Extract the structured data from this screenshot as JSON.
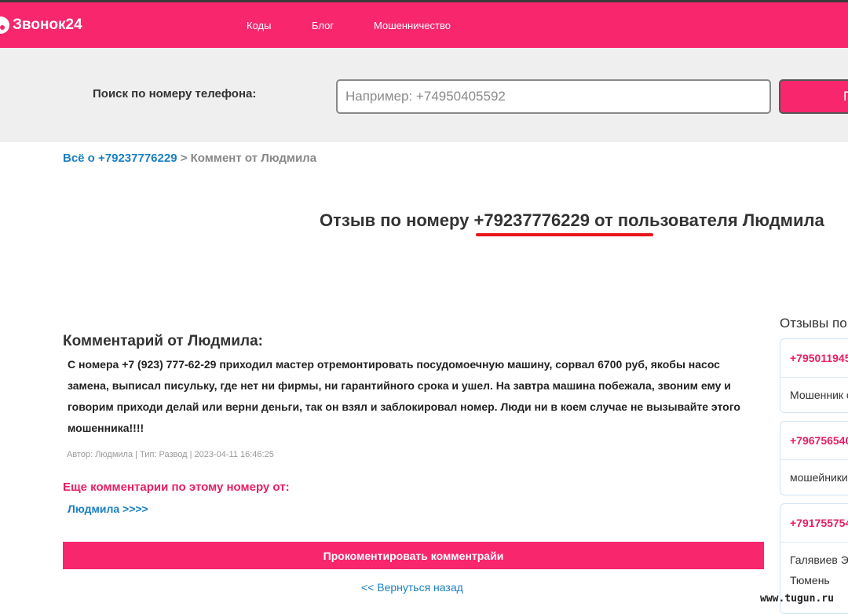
{
  "header": {
    "logo_text": "Звонок24",
    "nav": [
      "Коды",
      "Блог",
      "Мошенничество"
    ],
    "brand_color": "#f7266d"
  },
  "search": {
    "label": "Поиск по номеру телефона:",
    "placeholder": "Например: +74950405592",
    "button_label": "П"
  },
  "breadcrumb": {
    "link": "Всё о +79237776229",
    "separator": ">",
    "current": "Коммент от Людмила"
  },
  "review": {
    "title": "Отзыв по номеру +79237776229 от пользователя Людмила"
  },
  "comment": {
    "heading": "Комментарий от Людмила:",
    "text": "С номера +7 (923) 777-62-29 приходил мастер отремонтировать посудомоечную машину, сорвал 6700 руб, якобы насос замена, выписал писульку, где нет ни фирмы, ни гарантийного срока и ушел. На завтра машина побежала, звоним ему и говорим приходи делай или верни деньги, так он взял и заблокировал номер. Люди ни в коем случае не вызывайте этого мошенника!!!!",
    "meta": "Автор: Людмила | Тип: Развод | 2023-04-11 16:46:25",
    "more_label": "Еще комментарии по этому номеру от:",
    "more_link": "Людмила >>>>",
    "comment_button": "Прокоментировать комментрайи",
    "back_link": "<< Вернуться назад"
  },
  "sidebar": {
    "title": "Отзывы по",
    "cards": [
      {
        "phone": "+795011945",
        "lines": [
          "Мошенник с"
        ]
      },
      {
        "phone": "+796756540",
        "lines": [
          "мошейники"
        ]
      },
      {
        "phone": "+791755754",
        "lines": [
          "Галявиев Э",
          "Тюмень"
        ]
      }
    ]
  },
  "watermark": "www.tugun.ru"
}
